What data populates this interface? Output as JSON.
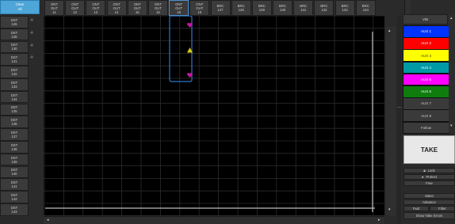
{
  "clear_all": {
    "line1": "Clear",
    "line2": "All"
  },
  "header": [
    {
      "l1": "ONT",
      "l2": "OUT",
      "l3": "11"
    },
    {
      "l1": "ONT",
      "l2": "OUT",
      "l3": "12"
    },
    {
      "l1": "ONT",
      "l2": "OUT",
      "l3": "13"
    },
    {
      "l1": "ONT",
      "l2": "OUT",
      "l3": "14"
    },
    {
      "l1": "ONT",
      "l2": "OUT",
      "l3": "15"
    },
    {
      "l1": "ONT",
      "l2": "OUT",
      "l3": "16"
    },
    {
      "l1": "ONT",
      "l2": "OUT",
      "l3": "18"
    },
    {
      "l1": "ONT",
      "l2": "OUT",
      "l3": "19"
    },
    {
      "l1": "BRC",
      "l2": "",
      "l3": "127"
    },
    {
      "l1": "BRC",
      "l2": "",
      "l3": "128"
    },
    {
      "l1": "BRC",
      "l2": "",
      "l3": "129"
    },
    {
      "l1": "BRC",
      "l2": "",
      "l3": "130"
    },
    {
      "l1": "BRC",
      "l2": "",
      "l3": "131"
    },
    {
      "l1": "BRC",
      "l2": "",
      "l3": "132"
    },
    {
      "l1": "BRC",
      "l2": "",
      "l3": "133"
    },
    {
      "l1": "BRC",
      "l2": "",
      "l3": "134"
    }
  ],
  "destinations": [
    {
      "l1": "DST",
      "l2": "126",
      "lock": "≟"
    },
    {
      "l1": "DST",
      "l2": "128",
      "lock": "≟"
    },
    {
      "l1": "DST",
      "l2": "130",
      "lock": "≟"
    },
    {
      "l1": "DST",
      "l2": "131",
      "lock": "≟"
    },
    {
      "l1": "DST",
      "l2": "132",
      "lock": ""
    },
    {
      "l1": "DST",
      "l2": "133",
      "lock": ""
    },
    {
      "l1": "DST",
      "l2": "134",
      "lock": ""
    },
    {
      "l1": "DST",
      "l2": "135",
      "lock": ""
    },
    {
      "l1": "DST",
      "l2": "136",
      "lock": ""
    },
    {
      "l1": "DST",
      "l2": "137",
      "lock": ""
    },
    {
      "l1": "DST",
      "l2": "138",
      "lock": ""
    },
    {
      "l1": "DST",
      "l2": "139",
      "lock": ""
    },
    {
      "l1": "DST",
      "l2": "140",
      "lock": ""
    },
    {
      "l1": "DST",
      "l2": "141",
      "lock": ""
    },
    {
      "l1": "DST",
      "l2": "142",
      "lock": ""
    },
    {
      "l1": "DST",
      "l2": "143",
      "lock": ""
    }
  ],
  "vib_panel": {
    "title": "VIB",
    "items": [
      {
        "label": "AUX 1",
        "color": "#0033ff",
        "text": "#ffffff"
      },
      {
        "label": "AUX 2",
        "color": "#ff0000",
        "text": "#ffffff"
      },
      {
        "label": "AUX 3",
        "color": "#ffff00",
        "text": "#333333"
      },
      {
        "label": "AUX 4",
        "color": "#009aa6",
        "text": "#ffffff"
      },
      {
        "label": "AUX 5",
        "color": "#ff00ff",
        "text": "#ffffff"
      },
      {
        "label": "AUX 6",
        "color": "#0e7d0e",
        "text": "#ffffff"
      },
      {
        "label": "AUX 7",
        "color": "#3a3a3a",
        "text": "#cfcfcf"
      },
      {
        "label": "AUX 8",
        "color": "#3a3a3a",
        "text": "#cfcfcf"
      },
      {
        "label": "Follow",
        "color": "#3a3a3a",
        "text": "#cfcfcf"
      }
    ]
  },
  "take_label": "TAKE",
  "right_buttons": {
    "lock": "Lock",
    "protect": "Protect",
    "free": "Free",
    "salvo": "Salvo",
    "advance": "Advance",
    "fwd": "Fwd",
    "filter": "Filter",
    "show_take_errors": "Show Take Errors"
  },
  "crosspoints": [
    {
      "row": 0,
      "col": 7,
      "color": "#c0179f",
      "icon": "heart-icon"
    },
    {
      "row": 2,
      "col": 7,
      "color": "#d4c81a",
      "icon": "triangle-icon"
    },
    {
      "row": 4,
      "col": 7,
      "color": "#c0179f",
      "icon": "heart-icon"
    }
  ],
  "colors": {
    "selection_border": "#2d74c8",
    "grid_line": "#2c2c2c"
  }
}
